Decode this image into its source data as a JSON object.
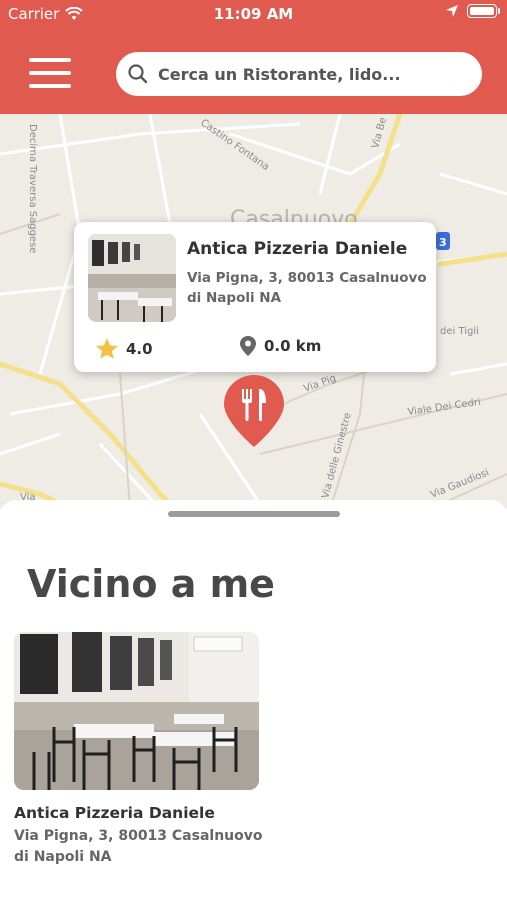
{
  "status_bar": {
    "carrier": "Carrier",
    "time": "11:09 AM"
  },
  "header": {
    "background_color": "#e05a4f",
    "menu_icon": "hamburger-menu-icon",
    "search": {
      "icon": "search-icon",
      "placeholder": "Cerca un Ristorante, lido..."
    }
  },
  "map": {
    "labels": {
      "street_1": "Decima Traversa Saggese",
      "street_2": "Castino Fontana",
      "street_3": "Via Be",
      "town": "Casalnuovo",
      "badge": "3",
      "street_4": "dei Tigli",
      "street_5": "Via Pig",
      "street_6": "Viale Dei Cedri",
      "street_7": "Via delle Ginestre",
      "street_8": "Via Gaudiosi",
      "street_9": "Via"
    },
    "popup": {
      "name": "Antica Pizzeria Daniele",
      "address": "Via Pigna, 3, 80013 Casalnuovo di Napoli NA",
      "rating": "4.0",
      "distance": "0.0 km"
    },
    "pin_color": "#e05a4f"
  },
  "nearby": {
    "title": "Vicino a me",
    "items": [
      {
        "name": "Antica Pizzeria Daniele",
        "address": "Via Pigna, 3, 80013 Casalnuovo di Napoli NA"
      }
    ]
  }
}
